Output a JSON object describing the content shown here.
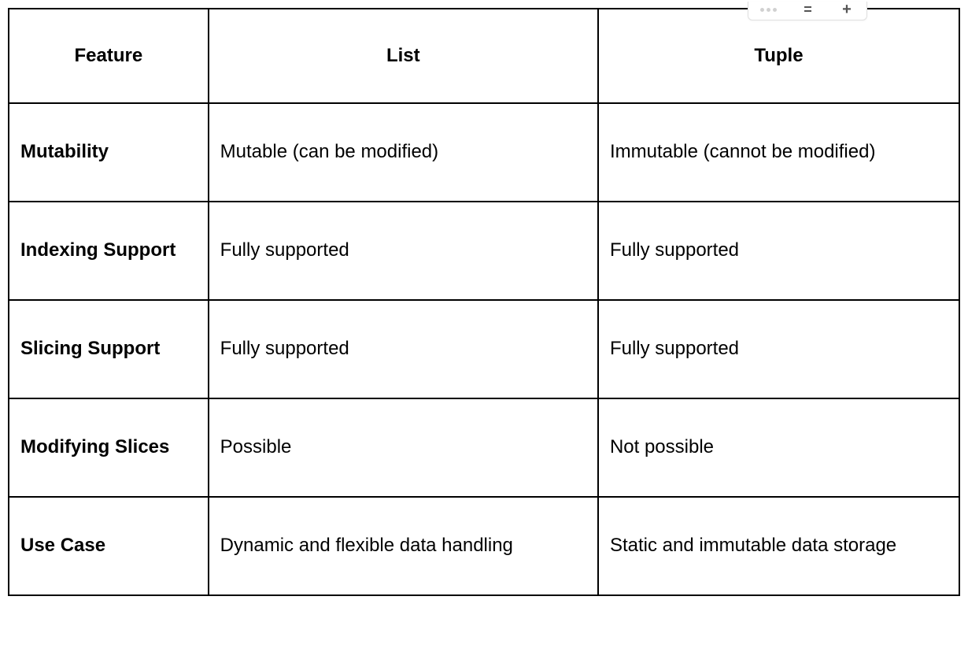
{
  "chart_data": {
    "type": "table",
    "headers": [
      "Feature",
      "List",
      "Tuple"
    ],
    "rows": [
      {
        "feature": "Mutability",
        "list": "Mutable (can be modified)",
        "tuple": "Immutable (cannot be modified)"
      },
      {
        "feature": "Indexing Support",
        "list": "Fully supported",
        "tuple": "Fully supported"
      },
      {
        "feature": "Slicing Support",
        "list": "Fully supported",
        "tuple": "Fully supported"
      },
      {
        "feature": "Modifying Slices",
        "list": "Possible",
        "tuple": "Not possible"
      },
      {
        "feature": "Use Case",
        "list": "Dynamic and flexible data handling",
        "tuple": "Static and immutable data storage"
      }
    ]
  },
  "toolbar": {
    "more": "more-options",
    "format": "format",
    "add": "add"
  }
}
